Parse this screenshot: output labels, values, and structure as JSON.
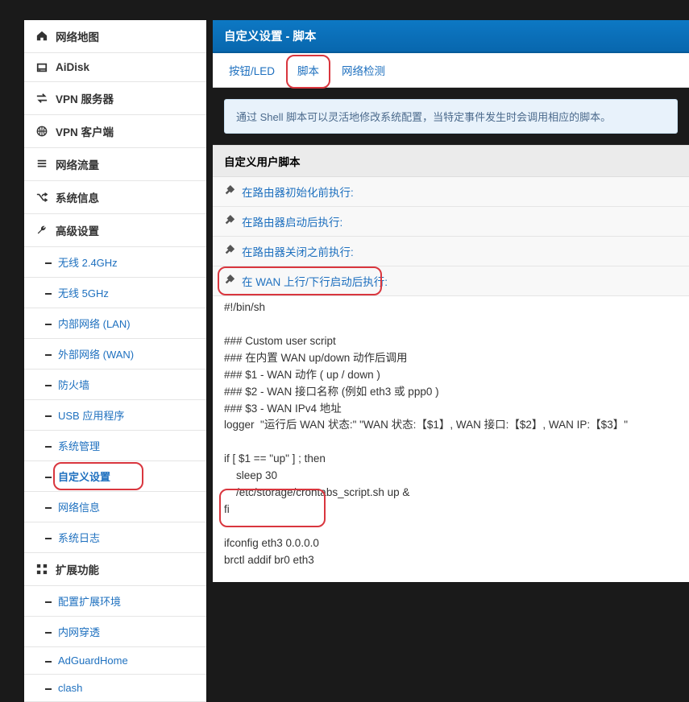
{
  "sidebar": {
    "items": [
      {
        "icon": "home",
        "label": "网络地图"
      },
      {
        "icon": "disk",
        "label": "AiDisk"
      },
      {
        "icon": "swap",
        "label": "VPN 服务器"
      },
      {
        "icon": "globe",
        "label": "VPN 客户端"
      },
      {
        "icon": "bars",
        "label": "网络流量"
      },
      {
        "icon": "shuffle",
        "label": "系统信息"
      },
      {
        "icon": "wrench",
        "label": "高级设置",
        "subs": [
          {
            "label": "无线 2.4GHz"
          },
          {
            "label": "无线 5GHz"
          },
          {
            "label": "内部网络 (LAN)"
          },
          {
            "label": "外部网络 (WAN)"
          },
          {
            "label": "防火墙"
          },
          {
            "label": "USB 应用程序"
          },
          {
            "label": "系统管理"
          },
          {
            "label": "自定义设置",
            "active": true,
            "highlight": true
          },
          {
            "label": "网络信息"
          },
          {
            "label": "系统日志"
          }
        ]
      },
      {
        "icon": "grid",
        "label": "扩展功能",
        "subs": [
          {
            "label": "配置扩展环境"
          },
          {
            "label": "内网穿透"
          },
          {
            "label": "AdGuardHome"
          },
          {
            "label": "clash"
          }
        ]
      }
    ]
  },
  "main": {
    "title": "自定义设置 - 脚本",
    "tabs": [
      {
        "label": "按钮/LED"
      },
      {
        "label": "脚本",
        "highlight": true
      },
      {
        "label": "网络检测"
      }
    ],
    "notice": "通过 Shell 脚本可以灵活地修改系统配置，当特定事件发生时会调用相应的脚本。",
    "section_header": "自定义用户脚本",
    "scripts": [
      {
        "label": "在路由器初始化前执行:"
      },
      {
        "label": "在路由器启动后执行:"
      },
      {
        "label": "在路由器关闭之前执行:"
      },
      {
        "label": "在 WAN 上行/下行启动后执行:",
        "highlight": true
      }
    ],
    "code": "#!/bin/sh\n\n### Custom user script\n### 在内置 WAN up/down 动作后调用\n### $1 - WAN 动作 ( up / down )\n### $2 - WAN 接口名称 (例如 eth3 或 ppp0 )\n### $3 - WAN IPv4 地址\nlogger  \"运行后 WAN 状态:\" \"WAN 状态:【$1】, WAN 接口:【$2】, WAN IP:【$3】\"\n\nif [ $1 == \"up\" ] ; then\n    sleep 30\n    /etc/storage/crontabs_script.sh up &\nfi\n\nifconfig eth3 0.0.0.0\nbrctl addif br0 eth3"
  }
}
